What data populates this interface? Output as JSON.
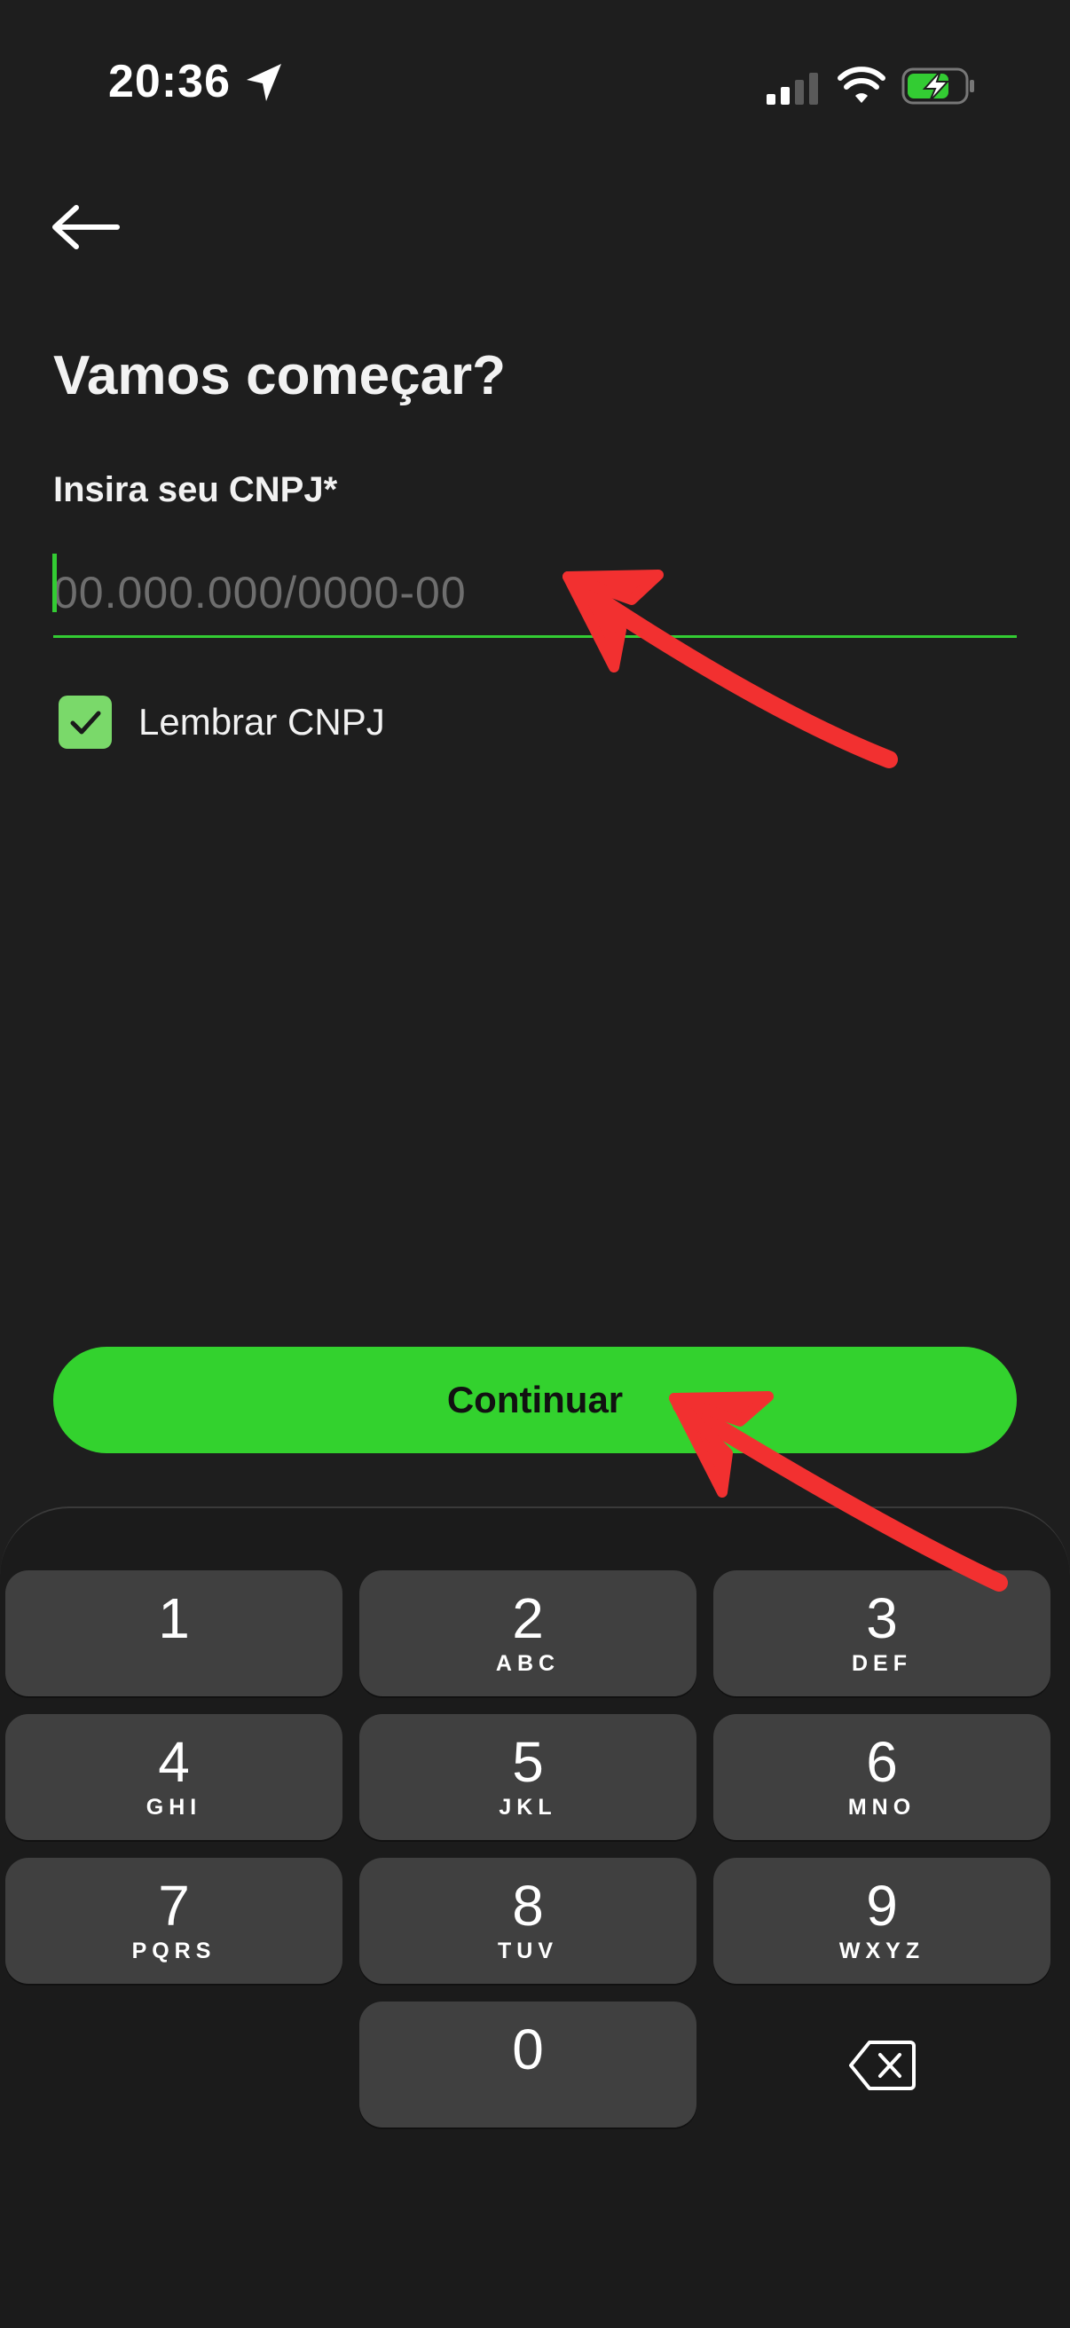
{
  "status_bar": {
    "time": "20:36",
    "icons": [
      "location-arrow-icon",
      "signal-icon",
      "wifi-icon",
      "battery-charging-icon"
    ]
  },
  "nav": {
    "back_icon": "arrow-left-icon"
  },
  "page": {
    "title": "Vamos começar?",
    "field_label": "Insira seu CNPJ*",
    "cnpj_placeholder": "00.000.000/0000-00",
    "cnpj_value": "",
    "remember_label": "Lembrar CNPJ",
    "remember_checked": true,
    "continue_label": "Continuar"
  },
  "keyboard": {
    "keys": [
      {
        "digit": "1",
        "letters": ""
      },
      {
        "digit": "2",
        "letters": "ABC"
      },
      {
        "digit": "3",
        "letters": "DEF"
      },
      {
        "digit": "4",
        "letters": "GHI"
      },
      {
        "digit": "5",
        "letters": "JKL"
      },
      {
        "digit": "6",
        "letters": "MNO"
      },
      {
        "digit": "7",
        "letters": "PQRS"
      },
      {
        "digit": "8",
        "letters": "TUV"
      },
      {
        "digit": "9",
        "letters": "WXYZ"
      },
      {
        "digit": "0",
        "letters": ""
      }
    ],
    "backspace_icon": "backspace-icon"
  },
  "colors": {
    "accent": "#33d22e",
    "background": "#1e1e1e",
    "key": "#404040",
    "annotation": "#f23030"
  }
}
